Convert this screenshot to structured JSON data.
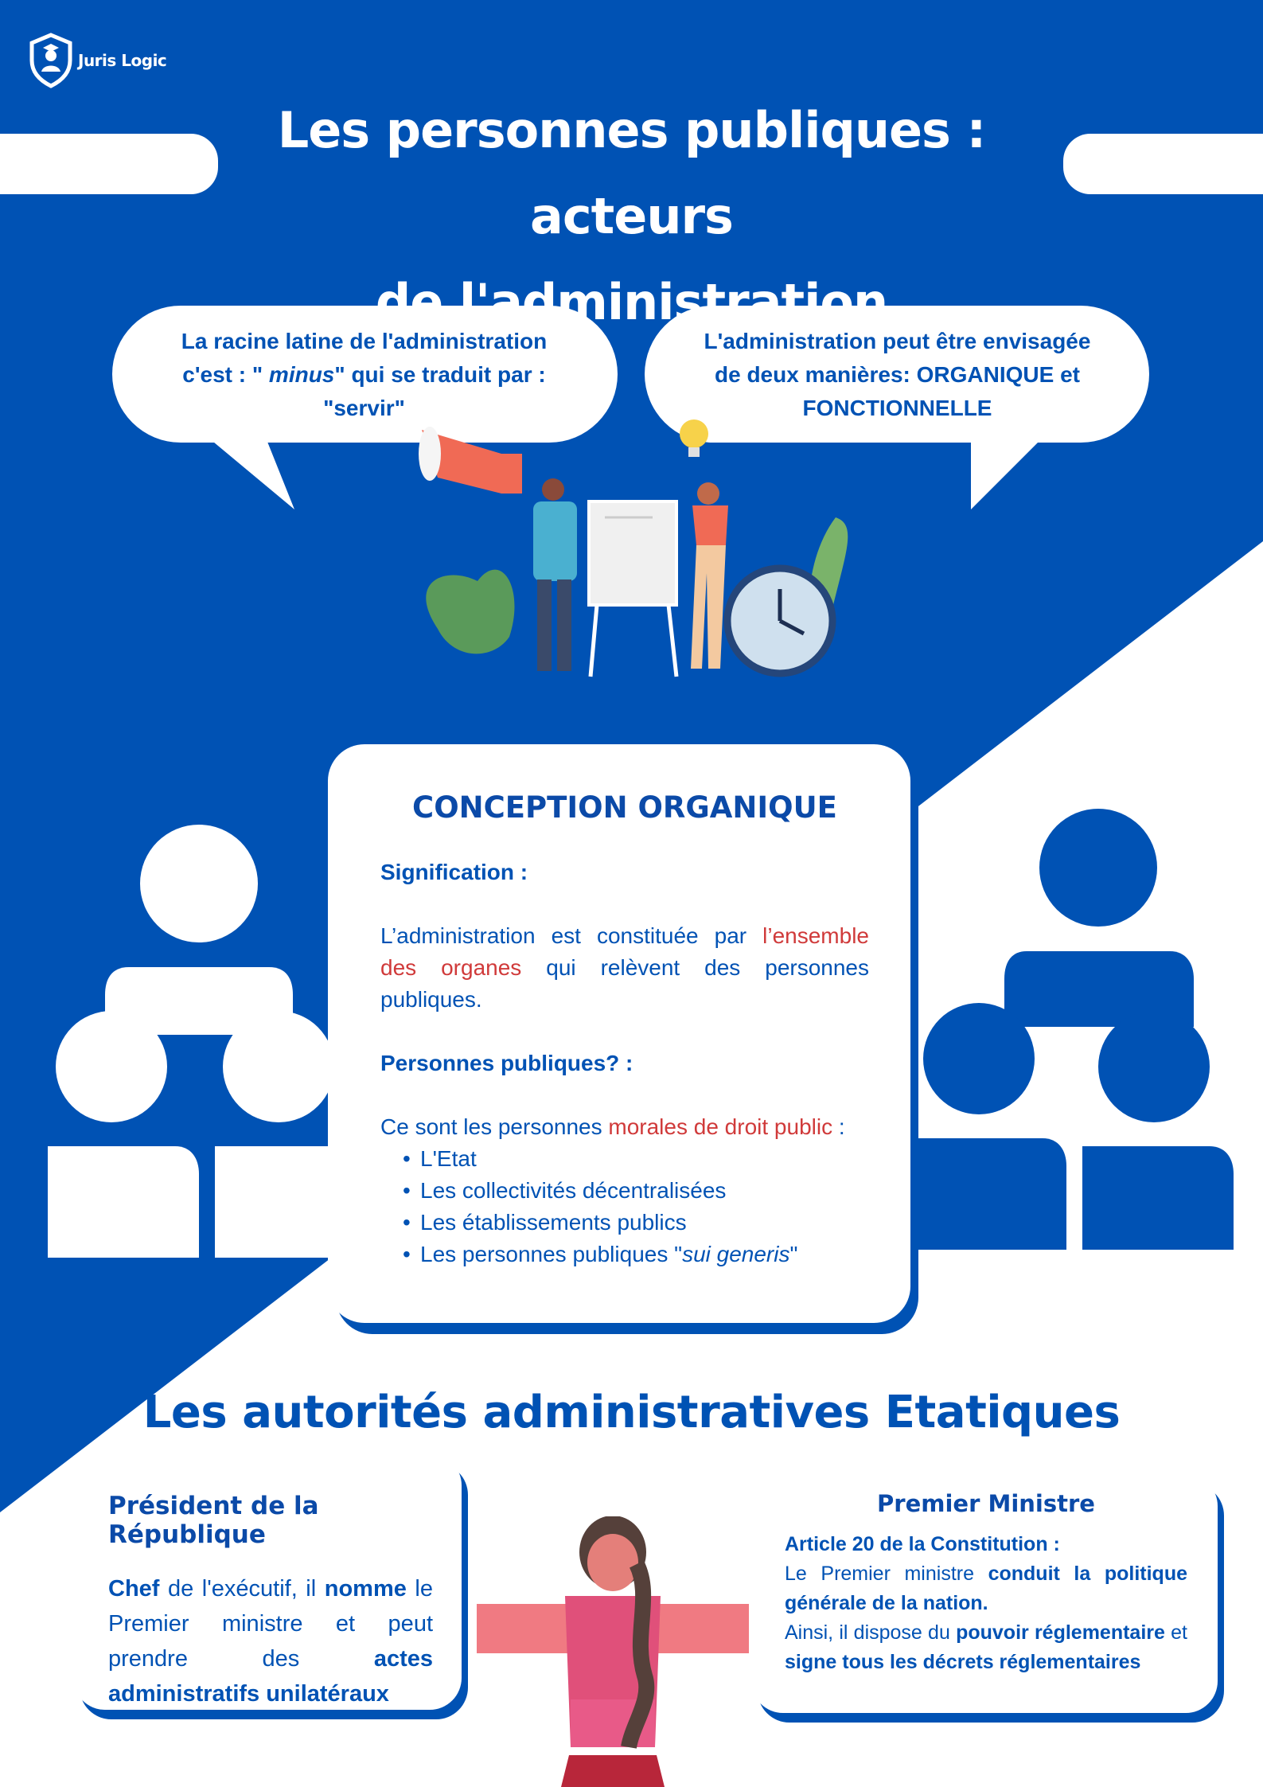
{
  "brand": {
    "name": "Juris Logic"
  },
  "title": {
    "line1": "Les personnes publiques : acteurs",
    "line2": "de l'administration"
  },
  "bubbles": {
    "left": {
      "t1": "La racine latine de l'administration",
      "t2a": "c'est : \" ",
      "t2b": "minus",
      "t2c": "\" qui se traduit par :",
      "t3": "\"servir\""
    },
    "right": {
      "t1": "L'administration peut être envisagée",
      "t2": "de deux manières: ORGANIQUE et",
      "t3": "FONCTIONNELLE"
    }
  },
  "organique": {
    "title": "CONCEPTION ORGANIQUE",
    "signification_label": "Signification :",
    "sig_a": "L’administration est constituée par ",
    "sig_red": "l’ensemble des organes",
    "sig_b": " qui relèvent des personnes publiques.",
    "pp_label": "Personnes publiques? :",
    "pp_a": "Ce sont les personnes ",
    "pp_red": "morales de droit public",
    "pp_b": " :",
    "items": [
      "L'Etat",
      "Les collectivités décentralisées",
      "Les établissements publics"
    ],
    "last_item_a": "Les personnes publiques \"",
    "last_item_b": "sui generis",
    "last_item_c": "\""
  },
  "autorites": {
    "title": "Les autorités administratives Etatiques"
  },
  "president": {
    "title": "Président de la République",
    "b1": "Chef",
    "t1": " de l'exécutif, il ",
    "b2": "nomme",
    "t2": " le Premier ministre et peut prendre des ",
    "b3": "actes administratifs unilatéraux"
  },
  "premier": {
    "title": "Premier Ministre",
    "article": "Article 20 de la Constitution :",
    "t1": "Le Premier ministre ",
    "b1": "conduit la politique générale de la nation.",
    "t2": "Ainsi, il dispose du ",
    "b2": "pouvoir réglementaire",
    "t3": " et ",
    "b3": "signe tous les décrets réglementaires"
  },
  "colors": {
    "primary": "#0052b4",
    "dark_title": "#0b4aa8",
    "highlight": "#d03a3a",
    "white": "#ffffff"
  }
}
